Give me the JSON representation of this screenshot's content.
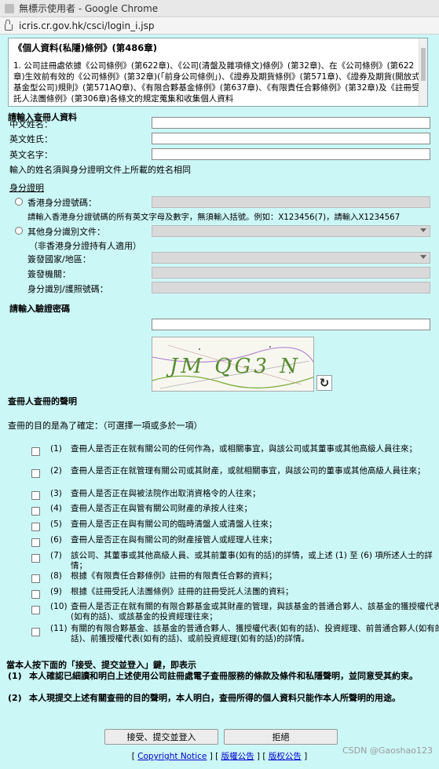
{
  "browser": {
    "title": "無標示使用者 - Google Chrome",
    "url": "icris.cr.gov.hk/csci/login_i.jsp"
  },
  "notice": {
    "heading": "《個人資料(私隱)條例》(第486章)",
    "para": "1. 公司註冊處依據《公司條例》(第622章)、《公司(清盤及雜項條文)條例》(第32章)、在《公司條例》(第622章)生效前有效的《公司條例》(第32章)(「前身公司條例」)、《證券及期貨條例》(第571章)、《證券及期貨(開放式基金型公司)規則》(第571AQ章)、《有限合夥基金條例》(第637章)、《有限責任合夥條例》(第32章)及《註冊受託人法團條例》(第306章)各條文的規定蒐集和收集個人資料"
  },
  "searcher": {
    "section_title": "請輸入查冊人資料",
    "chinese_name": "中文姓名：",
    "english_surname": "英文姓氏：",
    "english_given": "英文名字：",
    "name_note": "輸入的姓名須與身分證明文件上所載的姓名相同"
  },
  "identity": {
    "section_title": "身分證明",
    "hkid_label": "香港身分證號碼：",
    "hkid_note": "請輸入香港身分證號碼的所有英文字母及數字，無須輸入括號。例如：X123456(7)，請輸入X1234567",
    "other_label": "其他身分識別文件：",
    "other_note": "（非香港身分證持有人適用）",
    "issuing_country": "簽發國家/地區：",
    "issuing_authority": "簽發機關：",
    "doc_number": "身分識別/護照號碼："
  },
  "captcha": {
    "section_title": "請輸入驗證密碼",
    "image_text": "JM QG3 N",
    "refresh_icon": "refresh-icon"
  },
  "declaration": {
    "section_title": "查冊人查冊的聲明",
    "intro": "查冊的目的是為了確定：（可選擇一項或多於一項）",
    "items": [
      {
        "num": "(1)",
        "text": "查冊人是否正在就有關公司的任何作為，或相關事宜，與該公司或其董事或其他高級人員往來；"
      },
      {
        "num": "(2)",
        "text": "查冊人是否正在就管理有關公司或其財產，或就相關事宜，與該公司的董事或其他高級人員往來；"
      },
      {
        "num": "(3)",
        "text": "查冊人是否正在與被法院作出取消資格令的人往來；"
      },
      {
        "num": "(4)",
        "text": "查冊人是否正在與管有關公司財產的承按人往來；"
      },
      {
        "num": "(5)",
        "text": "查冊人是否正在與有關公司的臨時清盤人或清盤人往來；"
      },
      {
        "num": "(6)",
        "text": "查冊人是否正在與有關公司的財產接管人或經理人往來；"
      },
      {
        "num": "(7)",
        "text": "該公司、其董事或其他高級人員、或其前董事(如有的話)的詳情，或上述 (1) 至 (6) 項所述人士的詳情；"
      },
      {
        "num": "(8)",
        "text": "根據《有限責任合夥條例》註冊的有限責任合夥的資料；"
      },
      {
        "num": "(9)",
        "text": "根據《註冊受託人法團條例》註冊的註冊受託人法團的資料；"
      },
      {
        "num": "(10)",
        "text": "查冊人是否正在就有關的有限合夥基金或其財產的管理，與該基金的普通合夥人、該基金的獲授權代表(如有的話)、或該基金的投資經理往來；"
      },
      {
        "num": "(11)",
        "text": "有關的有限合夥基金、該基金的普通合夥人、獲授權代表(如有的話)、投資經理、前普通合夥人(如有的話)、前獲授權代表(如有的話)、或前投資經理(如有的話)的詳情。"
      }
    ]
  },
  "confirm": {
    "intro": "當本人按下面的「接受、提交並登入」鍵，即表示",
    "c1_num": "(1)",
    "c1": "本人確認已細讀和明白上述使用公司註冊處電子查冊服務的條款及條件和私隱聲明，並同意受其約束。",
    "c2_num": "(2)",
    "c2": "本人現提交上述有關查冊的目的聲明，本人明白，查冊所得的個人資料只能作本人所聲明的用途。"
  },
  "buttons": {
    "accept": "接受、提交並登入",
    "reject": "拒絕"
  },
  "footer": {
    "copyright": "Copyright Notice",
    "rights": "版權公告",
    "rights2": "版权公告"
  },
  "watermark": "CSDN @Gaoshao123"
}
